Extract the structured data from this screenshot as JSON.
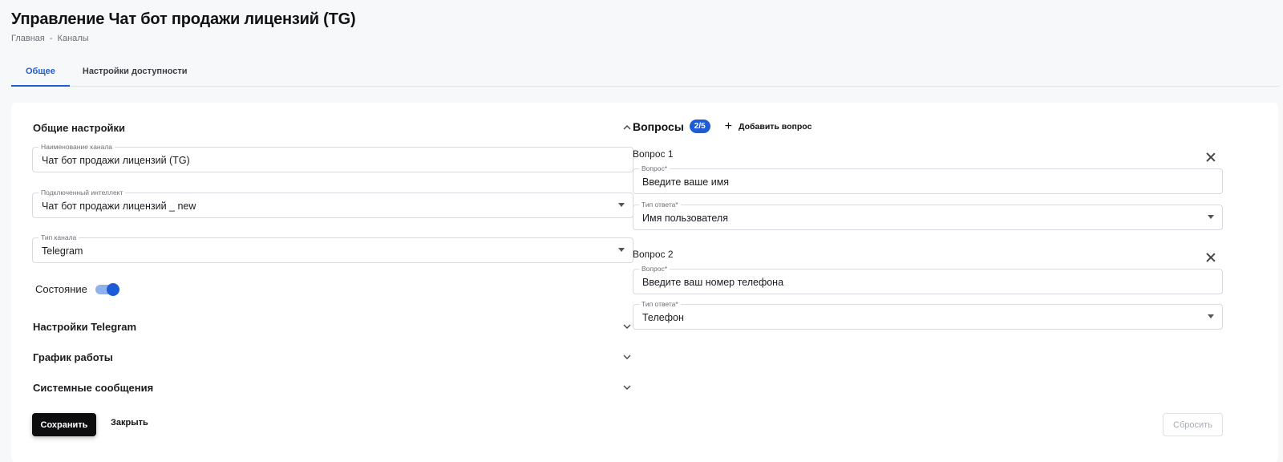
{
  "page": {
    "title": "Управление Чат бот продажи лицензий (TG)",
    "breadcrumb": [
      "Главная",
      "-",
      "Каналы"
    ]
  },
  "tabs": [
    {
      "label": "Общее",
      "active": true
    },
    {
      "label": "Настройки доступности",
      "active": false
    }
  ],
  "general": {
    "title": "Общие настройки",
    "channel_name": {
      "label": "Наименование канала",
      "value": "Чат бот продажи лицензий (TG)"
    },
    "intellect": {
      "label": "Подключенный интеллект",
      "value": "Чат бот продажи лицензий _ new"
    },
    "channel_type": {
      "label": "Тип канала",
      "value": "Telegram"
    },
    "state": {
      "label": "Состояние",
      "enabled": true
    }
  },
  "sections": [
    {
      "title": "Настройки Telegram"
    },
    {
      "title": "График работы"
    },
    {
      "title": "Системные сообщения"
    }
  ],
  "questions": {
    "title": "Вопросы",
    "badge": "2/5",
    "add_label": "Добавить вопрос",
    "items": [
      {
        "label": "Вопрос 1",
        "question_label": "Вопрос",
        "question_value": "Введите ваше имя",
        "answer_label": "Тип ответа",
        "answer_value": "Имя пользователя"
      },
      {
        "label": "Вопрос 2",
        "question_label": "Вопрос",
        "question_value": "Введите ваш номер телефона",
        "answer_label": "Тип ответа",
        "answer_value": "Телефон"
      }
    ],
    "required_mark": "*"
  },
  "actions": {
    "save": "Сохранить",
    "close": "Закрыть",
    "reset": "Сбросить"
  },
  "colors": {
    "accent": "#1e5bd7",
    "primary_button": "#0d0d0f",
    "background": "#f7f8fa"
  }
}
